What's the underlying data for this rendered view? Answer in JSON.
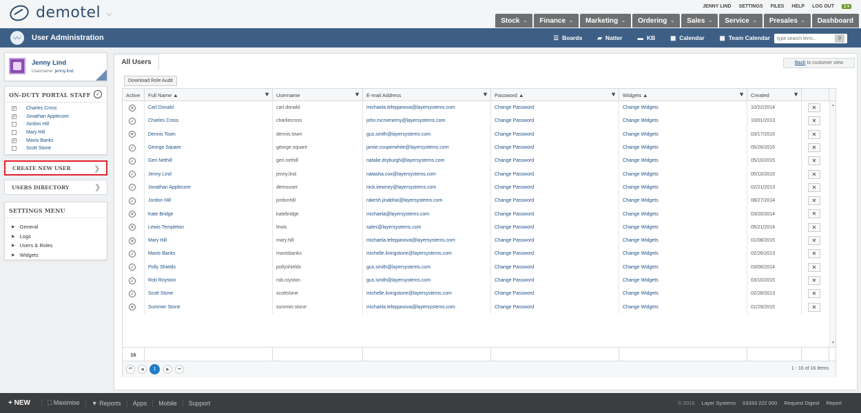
{
  "app": {
    "logo_text": "demotel",
    "logo_caret": "⌵"
  },
  "toplinks": {
    "user": "JENNY LIND",
    "settings": "SETTINGS",
    "files": "FILES",
    "help": "HELP",
    "logout": "LOG OUT",
    "badge": "1 ▾"
  },
  "menu_tabs": [
    {
      "label": "Stock",
      "caret": "⌄"
    },
    {
      "label": "Finance",
      "caret": "⌄"
    },
    {
      "label": "Marketing",
      "caret": "⌄"
    },
    {
      "label": "Ordering",
      "caret": "⌄"
    },
    {
      "label": "Sales",
      "caret": "⌄"
    },
    {
      "label": "Service",
      "caret": "⌄"
    },
    {
      "label": "Presales",
      "caret": "⌄"
    },
    {
      "label": "Dashboard",
      "caret": ""
    }
  ],
  "navbar": {
    "title": "User Administration",
    "links": [
      {
        "icon": "☰",
        "label": "Boards"
      },
      {
        "icon": "▰",
        "label": "Natter"
      },
      {
        "icon": "▬",
        "label": "KB"
      },
      {
        "icon": "▦",
        "label": "Calendar"
      },
      {
        "icon": "▦",
        "label": "Team Calendar"
      }
    ],
    "search_placeholder": "type search term...",
    "search_button": "⚲"
  },
  "user_card": {
    "name": "Jenny Lind",
    "username_label": "Username:",
    "username": "jenny.lind"
  },
  "staff": {
    "heading": "ON-DUTY PORTAL STAFF",
    "check_glyph": "✓",
    "members": [
      {
        "name": "Charles Cross",
        "checked": "✓"
      },
      {
        "name": "Jonathan Applecore",
        "checked": "✓"
      },
      {
        "name": "Jordon Hill",
        "checked": ""
      },
      {
        "name": "Mary Hill",
        "checked": ""
      },
      {
        "name": "Mavis Banks",
        "checked": "✓"
      },
      {
        "name": "Scott Stone",
        "checked": ""
      }
    ]
  },
  "sidebar": {
    "create_user": "CREATE NEW USER",
    "users_directory": "USERS DIRECTORY",
    "arrow": "❯",
    "settings_heading": "SETTINGS MENU",
    "settings_items": [
      "General",
      "Logs",
      "Users & Roles",
      "Widgets"
    ],
    "tri": "▶"
  },
  "main": {
    "tab": "All Users",
    "back_link": "Back",
    "back_rest": "to customer view",
    "audit_button": "Download Role Audit"
  },
  "grid": {
    "columns": [
      {
        "label": "Active",
        "filter": ""
      },
      {
        "label": "Full Name ▲",
        "filter": "▼"
      },
      {
        "label": "Username",
        "filter": "▼"
      },
      {
        "label": "E-mail Address",
        "filter": "▼"
      },
      {
        "label": "Password ▲",
        "filter": "▼"
      },
      {
        "label": "Widgets ▲",
        "filter": "▼"
      },
      {
        "label": "Created",
        "filter": "▼"
      },
      {
        "label": "",
        "filter": ""
      }
    ],
    "rows": [
      {
        "active": "✕",
        "name": "Carl Donald",
        "username": "carl.donald",
        "email": "michaela.telepjanova@layersystems.com",
        "password": "Change Password",
        "widgets": "Change Widgets",
        "created": "10/22/2014",
        "del": "✕"
      },
      {
        "active": "✓",
        "name": "Charles Cross",
        "username": "charliecross",
        "email": "john.mcmenemy@layersystems.com",
        "password": "Change Password",
        "widgets": "Change Widgets",
        "created": "10/01/2013",
        "del": "✕"
      },
      {
        "active": "✕",
        "name": "Dennis Town",
        "username": "dennis.town",
        "email": "gus.smith@layersystems.com",
        "password": "Change Password",
        "widgets": "Change Widgets",
        "created": "03/17/2015",
        "del": "✕"
      },
      {
        "active": "✓",
        "name": "George Square",
        "username": "george.square",
        "email": "jamie.couperwhite@layersystems.com",
        "password": "Change Password",
        "widgets": "Change Widgets",
        "created": "05/26/2015",
        "del": "✕"
      },
      {
        "active": "✓",
        "name": "Geri Nethill",
        "username": "geri.nethill",
        "email": "natalie.dryburgh@layersystems.com",
        "password": "Change Password",
        "widgets": "Change Widgets",
        "created": "05/10/2015",
        "del": "✕"
      },
      {
        "active": "✓",
        "name": "Jenny Lind",
        "username": "jenny.lind",
        "email": "natasha.cox@layersystems.com",
        "password": "Change Password",
        "widgets": "Change Widgets",
        "created": "05/10/2015",
        "del": "✕"
      },
      {
        "active": "✓",
        "name": "Jonathan Applecore",
        "username": "demouser",
        "email": "nick.kewney@layersystems.com",
        "password": "Change Password",
        "widgets": "Change Widgets",
        "created": "02/21/2013",
        "del": "✕"
      },
      {
        "active": "✓",
        "name": "Jordon Hill",
        "username": "jordonhill",
        "email": "rakesh.jinabhai@layersystems.com",
        "password": "Change Password",
        "widgets": "Change Widgets",
        "created": "08/27/2014",
        "del": "✕"
      },
      {
        "active": "✕",
        "name": "Kate Bridge",
        "username": "katebridge",
        "email": "michaela@layersystems.com",
        "password": "Change Password",
        "widgets": "Change Widgets",
        "created": "03/20/2014",
        "del": "✕"
      },
      {
        "active": "✕",
        "name": "Lewis Templeton",
        "username": "lewis",
        "email": "sales@layersystems.com",
        "password": "Change Password",
        "widgets": "Change Widgets",
        "created": "05/21/2014",
        "del": "✕"
      },
      {
        "active": "✕",
        "name": "Mary Hill",
        "username": "mary.hill",
        "email": "michaela.telepjanova@layersystems.com",
        "password": "Change Password",
        "widgets": "Change Widgets",
        "created": "01/08/2015",
        "del": "✕"
      },
      {
        "active": "✓",
        "name": "Mavis Banks",
        "username": "mavisbanks",
        "email": "michelle.livingstone@layersystems.com",
        "password": "Change Password",
        "widgets": "Change Widgets",
        "created": "02/26/2013",
        "del": "✕"
      },
      {
        "active": "✓",
        "name": "Polly Shields",
        "username": "pollyshields",
        "email": "gus.smith@layersystems.com",
        "password": "Change Password",
        "widgets": "Change Widgets",
        "created": "03/06/2014",
        "del": "✕"
      },
      {
        "active": "✓",
        "name": "Rob Royston",
        "username": "rob.royston",
        "email": "gus.smith@layersystems.com",
        "password": "Change Password",
        "widgets": "Change Widgets",
        "created": "03/10/2015",
        "del": "✕"
      },
      {
        "active": "✓",
        "name": "Scott Stone",
        "username": "scottstone",
        "email": "michelle.livingstone@layersystems.com",
        "password": "Change Password",
        "widgets": "Change Widgets",
        "created": "02/28/2013",
        "del": "✕"
      },
      {
        "active": "✕",
        "name": "Summer Stone",
        "username": "summer.stone",
        "email": "michaela.telepjanova@layersystems.com",
        "password": "Change Password",
        "widgets": "Change Widgets",
        "created": "01/29/2015",
        "del": "✕"
      }
    ],
    "count": "16",
    "pager": {
      "first": "⏮",
      "prev": "◀",
      "page": "1",
      "next": "▶",
      "last": "⏭"
    },
    "pager_info": "1 - 16 of 16 items",
    "scroll_up": "▲",
    "scroll_down": "▼"
  },
  "footer": {
    "new": "+ NEW",
    "items": [
      "⛶ Maximise",
      "▼ Reports",
      "Apps",
      "Mobile",
      "Support"
    ],
    "copyright": "© 2015",
    "company": "Layer Systems",
    "phone": "03333 222 000",
    "request_digest": "Request Digest",
    "report": "Report"
  }
}
